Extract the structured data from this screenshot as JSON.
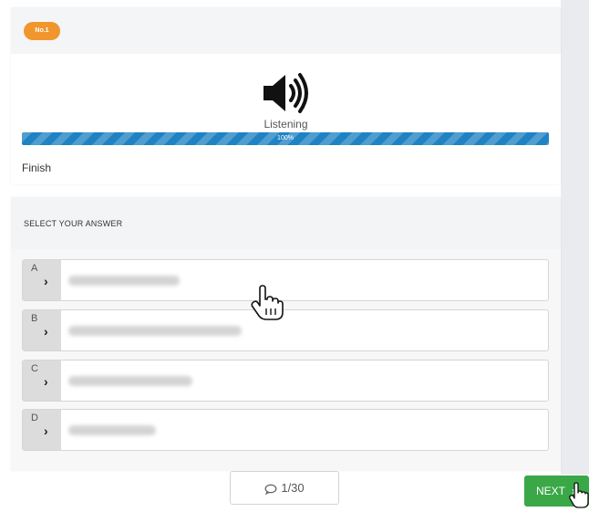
{
  "question": {
    "badge": "No.1",
    "speaker_icon": "speaker-volume-icon",
    "label": "Listening",
    "progress_percent": 100,
    "progress_text": "100%",
    "status": "Finish"
  },
  "answers_section": {
    "title": "SELECT YOUR ANSWER",
    "options": [
      {
        "letter": "A",
        "text_blurred": true
      },
      {
        "letter": "B",
        "text_blurred": true
      },
      {
        "letter": "C",
        "text_blurred": true
      },
      {
        "letter": "D",
        "text_blurred": true
      }
    ]
  },
  "footer": {
    "counter": "1/30",
    "counter_icon": "chat-bubble-icon",
    "next_label": "NEXT"
  },
  "colors": {
    "badge": "#f0962c",
    "progress": "#1f82c3",
    "next_button": "#3aa847"
  }
}
